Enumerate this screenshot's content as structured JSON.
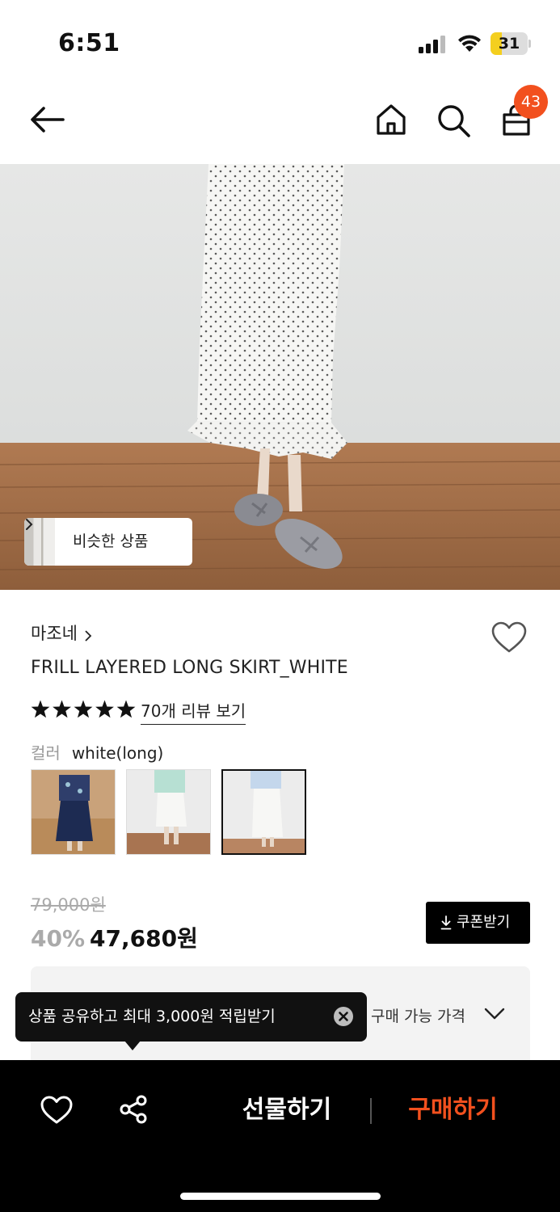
{
  "status_bar": {
    "time": "6:51",
    "battery_level": "31",
    "battery_color": "#f4cf1f"
  },
  "nav": {
    "icons": [
      "back-arrow-icon",
      "home-icon",
      "search-icon",
      "shopping-bag-icon"
    ],
    "cart_count": "43",
    "badge_color": "#f2501e"
  },
  "hero": {
    "similar_products_label": "비슷한 상품"
  },
  "product": {
    "brand": "마조네",
    "title": "FRILL LAYERED LONG SKIRT_WHITE",
    "star_count": 5,
    "review_link": "70개 리뷰 보기",
    "color_label": "컬러",
    "color_value": "white(long)",
    "swatches": [
      {
        "name": "navy",
        "selected": false
      },
      {
        "name": "white-short",
        "selected": false
      },
      {
        "name": "white-long",
        "selected": true
      }
    ]
  },
  "price": {
    "original": "79,000원",
    "discount": "40%",
    "final": "47,680원",
    "coupon_button": "쿠폰받기"
  },
  "price_box": {
    "label": "구매 가능 가격"
  },
  "tooltip": {
    "text": "상품 공유하고 최대 3,000원 적립받기"
  },
  "bottom_bar": {
    "gift_button": "선물하기",
    "buy_button": "구매하기",
    "accent_color": "#f2501e"
  }
}
